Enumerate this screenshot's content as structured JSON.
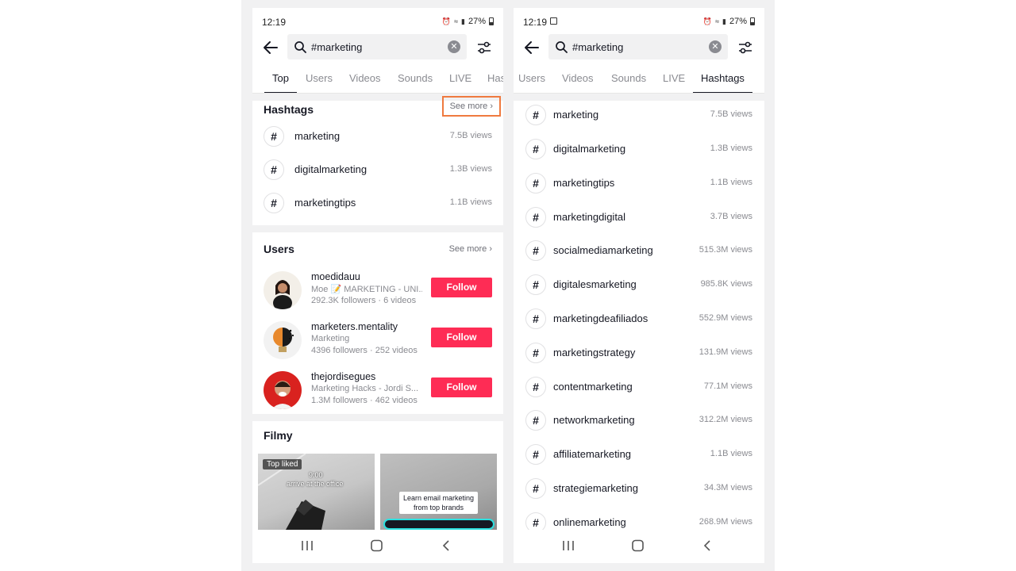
{
  "status_bar": {
    "time": "12:19",
    "battery": "27%"
  },
  "search": {
    "query": "#marketing"
  },
  "left": {
    "tabs": [
      "Top",
      "Users",
      "Videos",
      "Sounds",
      "LIVE",
      "Has"
    ],
    "hashtags_section": {
      "title": "Hashtags",
      "see_more": "See more ›",
      "items": [
        {
          "name": "marketing",
          "views": "7.5B views"
        },
        {
          "name": "digitalmarketing",
          "views": "1.3B views"
        },
        {
          "name": "marketingtips",
          "views": "1.1B views"
        }
      ]
    },
    "users_section": {
      "title": "Users",
      "see_more": "See more ›",
      "items": [
        {
          "username": "moedidauu",
          "desc": "Moe 📝 MARKETING - UNI...",
          "stats": "292.3K followers · 6 videos",
          "follow": "Follow"
        },
        {
          "username": "marketers.mentality",
          "desc": "Marketing",
          "stats": "4396 followers · 252 videos",
          "follow": "Follow"
        },
        {
          "username": "thejordisegues",
          "desc": "Marketing Hacks - Jordi S...",
          "stats": "1.3M followers · 462 videos",
          "follow": "Follow"
        }
      ]
    },
    "films_section": {
      "title": "Filmy",
      "videos": [
        {
          "badge": "Top liked",
          "text_1": "9:00",
          "text_2": "arrive at the office"
        },
        {
          "text_1": "Learn email marketing",
          "text_2": "from top brands"
        }
      ]
    }
  },
  "right": {
    "tabs": [
      "Users",
      "Videos",
      "Sounds",
      "LIVE",
      "Hashtags"
    ],
    "hashtags": [
      {
        "name": "marketing",
        "views": "7.5B views"
      },
      {
        "name": "digitalmarketing",
        "views": "1.3B views"
      },
      {
        "name": "marketingtips",
        "views": "1.1B views"
      },
      {
        "name": "marketingdigital",
        "views": "3.7B views"
      },
      {
        "name": "socialmediamarketing",
        "views": "515.3M views"
      },
      {
        "name": "digitalesmarketing",
        "views": "985.8K views"
      },
      {
        "name": "marketingdeafiliados",
        "views": "552.9M views"
      },
      {
        "name": "marketingstrategy",
        "views": "131.9M views"
      },
      {
        "name": "contentmarketing",
        "views": "77.1M views"
      },
      {
        "name": "networkmarketing",
        "views": "312.2M views"
      },
      {
        "name": "affiliatemarketing",
        "views": "1.1B views"
      },
      {
        "name": "strategiemarketing",
        "views": "34.3M views"
      },
      {
        "name": "onlinemarketing",
        "views": "268.9M views"
      }
    ]
  },
  "colors": {
    "accent": "#fe2c55",
    "highlight": "#ef7a3f"
  },
  "icons": [
    "back-arrow-icon",
    "search-icon",
    "clear-icon",
    "filter-icon",
    "hash-icon",
    "recents-icon",
    "home-icon",
    "nav-back-icon"
  ]
}
